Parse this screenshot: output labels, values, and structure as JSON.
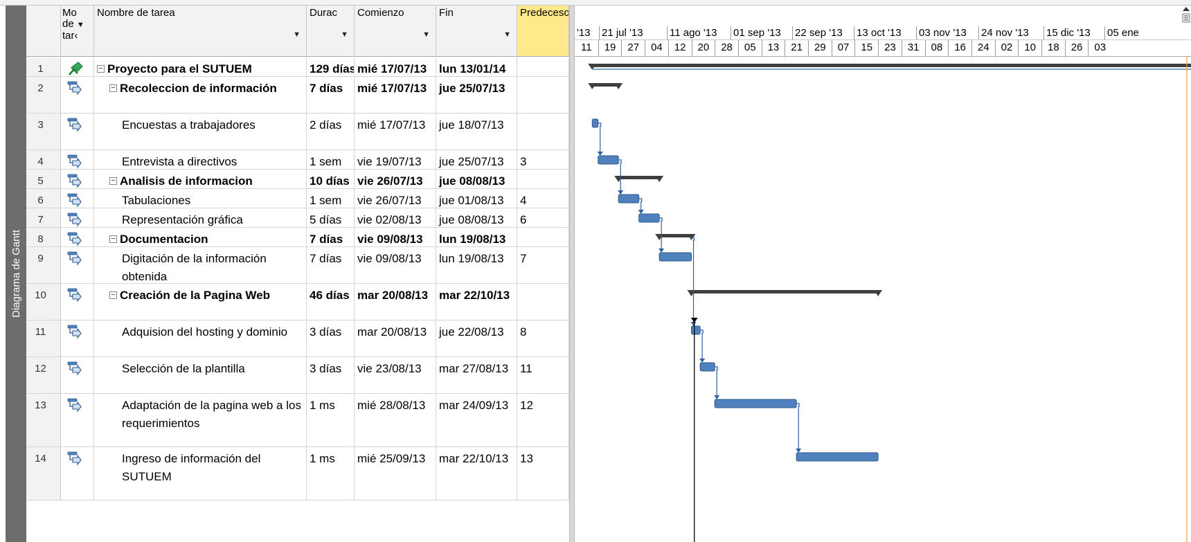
{
  "viewbar": {
    "label": "Diagrama de Gantt"
  },
  "columns": {
    "mode": "Mo de ▾ tar",
    "mode_line1": "Mo",
    "mode_line2": "de",
    "mode_line3": "tar‹",
    "name": "Nombre de tarea",
    "duration": "Durac",
    "start": "Comienzo",
    "end": "Fin",
    "predecessors": "Predecesoras"
  },
  "tasks": [
    {
      "id": "1",
      "name": "Proyecto para el SUTUEM",
      "duration": "129 días",
      "start": "mié 17/07/13",
      "end": "lun 13/01/14",
      "pred": "",
      "summary": true,
      "level": 0,
      "mode": "pin"
    },
    {
      "id": "2",
      "name": "Recoleccion de información",
      "duration": "7 días",
      "start": "mié 17/07/13",
      "end": "jue 25/07/13",
      "pred": "",
      "summary": true,
      "level": 1,
      "mode": "auto"
    },
    {
      "id": "3",
      "name": "Encuestas a trabajadores",
      "duration": "2 días",
      "start": "mié 17/07/13",
      "end": "jue 18/07/13",
      "pred": "",
      "summary": false,
      "level": 2,
      "mode": "auto"
    },
    {
      "id": "4",
      "name": "Entrevista a directivos",
      "duration": "1 sem",
      "start": "vie 19/07/13",
      "end": "jue 25/07/13",
      "pred": "3",
      "summary": false,
      "level": 2,
      "mode": "auto"
    },
    {
      "id": "5",
      "name": "Analisis de informacion",
      "duration": "10 días",
      "start": "vie 26/07/13",
      "end": "jue 08/08/13",
      "pred": "",
      "summary": true,
      "level": 1,
      "mode": "auto"
    },
    {
      "id": "6",
      "name": "Tabulaciones",
      "duration": "1 sem",
      "start": "vie 26/07/13",
      "end": "jue 01/08/13",
      "pred": "4",
      "summary": false,
      "level": 2,
      "mode": "auto"
    },
    {
      "id": "7",
      "name": "Representación gráfica",
      "duration": "5 días",
      "start": "vie 02/08/13",
      "end": "jue 08/08/13",
      "pred": "6",
      "summary": false,
      "level": 2,
      "mode": "auto"
    },
    {
      "id": "8",
      "name": "Documentacion",
      "duration": "7 días",
      "start": "vie 09/08/13",
      "end": "lun 19/08/13",
      "pred": "",
      "summary": true,
      "level": 1,
      "mode": "auto"
    },
    {
      "id": "9",
      "name": "Digitación de la información obtenida",
      "duration": "7 días",
      "start": "vie 09/08/13",
      "end": "lun 19/08/13",
      "pred": "7",
      "summary": false,
      "level": 2,
      "mode": "auto"
    },
    {
      "id": "10",
      "name": "Creación de la Pagina Web",
      "duration": "46 días",
      "start": "mar 20/08/13",
      "end": "mar 22/10/13",
      "pred": "",
      "summary": true,
      "level": 1,
      "mode": "auto"
    },
    {
      "id": "11",
      "name": "Adquision del hosting y dominio",
      "duration": "3 días",
      "start": "mar 20/08/13",
      "end": "jue 22/08/13",
      "pred": "8",
      "summary": false,
      "level": 2,
      "mode": "auto"
    },
    {
      "id": "12",
      "name": "Selección de la plantilla",
      "duration": "3 días",
      "start": "vie 23/08/13",
      "end": "mar 27/08/13",
      "pred": "11",
      "summary": false,
      "level": 2,
      "mode": "auto"
    },
    {
      "id": "13",
      "name": "Adaptación de la pagina web a los requerimientos",
      "duration": "1 ms",
      "start": "mié 28/08/13",
      "end": "mar 24/09/13",
      "pred": "12",
      "summary": false,
      "level": 2,
      "mode": "auto"
    },
    {
      "id": "14",
      "name": "Ingreso de información del SUTUEM",
      "duration": "1 ms",
      "start": "mié 25/09/13",
      "end": "mar 22/10/13",
      "pred": "13",
      "summary": false,
      "level": 2,
      "mode": "auto"
    }
  ],
  "timescale": {
    "top": [
      "'13",
      "21 jul '13",
      "11 ago '13",
      "01 sep '13",
      "22 sep '13",
      "13 oct '13",
      "03 nov '13",
      "24 nov '13",
      "15 dic '13",
      "05 ene"
    ],
    "bottom": [
      "11",
      "19",
      "27",
      "04",
      "12",
      "20",
      "28",
      "05",
      "13",
      "21",
      "29",
      "07",
      "15",
      "23",
      "31",
      "08",
      "16",
      "24",
      "02",
      "10",
      "18",
      "26",
      "03"
    ]
  },
  "colors": {
    "task_bar": "#4f81bd",
    "summary_bar": "#3f3f3f",
    "link": "#2f5f9f",
    "status_line": "#000000",
    "predecessor_header": "#ffe98a"
  }
}
